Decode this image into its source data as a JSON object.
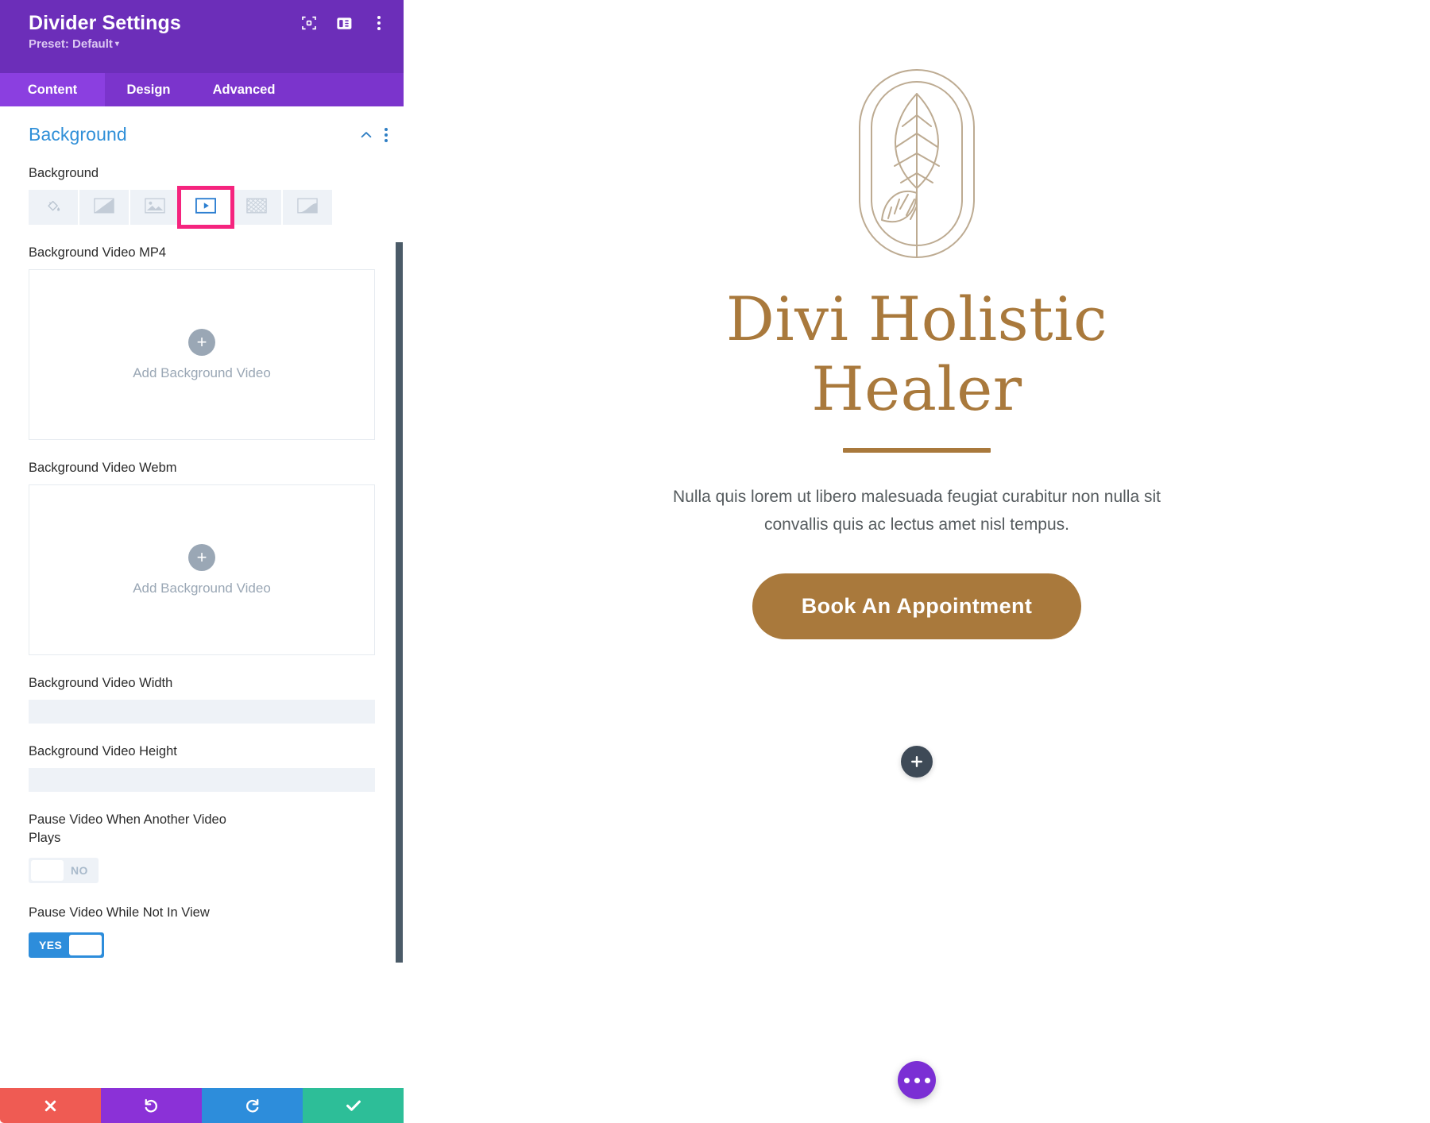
{
  "panel": {
    "title": "Divider Settings",
    "preset_label": "Preset: Default",
    "caret": "▾",
    "header_icons": [
      {
        "name": "focus-icon"
      },
      {
        "name": "layout-toggle-icon"
      },
      {
        "name": "more-options-icon"
      }
    ],
    "tabs": [
      {
        "label": "Content",
        "active": true
      },
      {
        "label": "Design",
        "active": false
      },
      {
        "label": "Advanced",
        "active": false
      }
    ],
    "section": {
      "title": "Background",
      "collapse_icon": "chevron-up-icon",
      "menu_icon": "more-options-icon"
    },
    "background_field_label": "Background",
    "background_types": [
      {
        "name": "background-color",
        "icon": "paint-bucket-icon",
        "selected": false
      },
      {
        "name": "background-gradient",
        "icon": "gradient-icon",
        "selected": false
      },
      {
        "name": "background-image",
        "icon": "image-icon",
        "selected": false
      },
      {
        "name": "background-video",
        "icon": "video-play-icon",
        "selected": true
      },
      {
        "name": "background-pattern",
        "icon": "pattern-icon",
        "selected": false
      },
      {
        "name": "background-mask",
        "icon": "mask-icon",
        "selected": false
      }
    ],
    "highlight_color": "#f5247e",
    "fields": {
      "mp4_label": "Background Video MP4",
      "mp4_upload_text": "Add Background Video",
      "webm_label": "Background Video Webm",
      "webm_upload_text": "Add Background Video",
      "width_label": "Background Video Width",
      "width_value": "",
      "width_placeholder": "",
      "height_label": "Background Video Height",
      "height_value": "",
      "height_placeholder": "",
      "pause_other_label": "Pause Video When Another Video Plays",
      "pause_other_state": "NO",
      "pause_notinview_label": "Pause Video While Not In View",
      "pause_notinview_state": "YES"
    },
    "footer": [
      {
        "name": "cancel-button",
        "icon": "close-icon",
        "color": "#ef5b53"
      },
      {
        "name": "undo-button",
        "icon": "undo-icon",
        "color": "#8b31d7"
      },
      {
        "name": "redo-button",
        "icon": "redo-icon",
        "color": "#2d8ddb"
      },
      {
        "name": "save-button",
        "icon": "check-icon",
        "color": "#2dbe98"
      }
    ]
  },
  "preview": {
    "logo_name": "leaf-plant-logo",
    "title": "Divi Holistic Healer",
    "subtitle": "Nulla quis lorem ut libero malesuada feugiat curabitur non nulla sit convallis quis ac lectus amet nisl tempus.",
    "cta_label": "Book An Appointment",
    "add_row_icon": "plus-icon",
    "fab_icon": "ellipsis-icon",
    "accent_color": "#a9793c"
  }
}
